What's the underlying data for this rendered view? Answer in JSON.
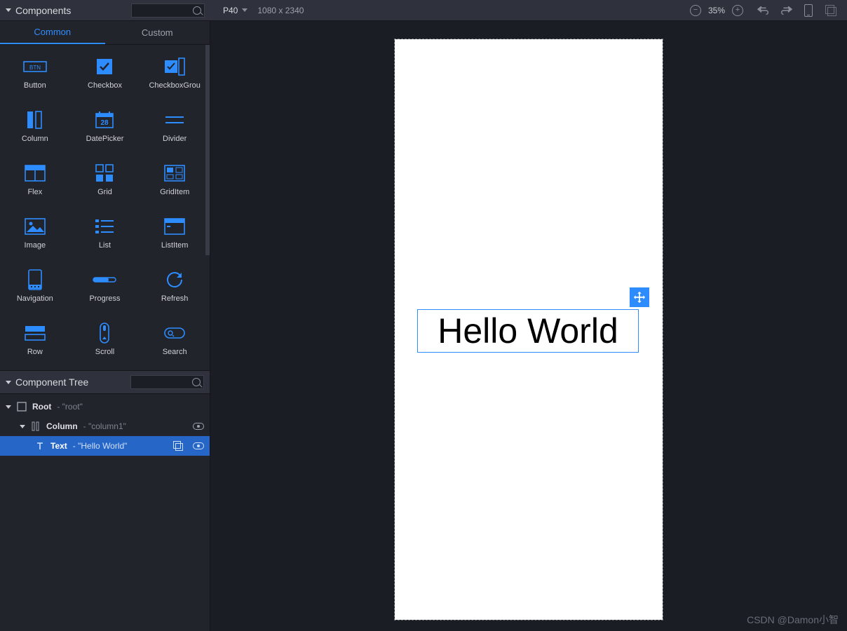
{
  "panels": {
    "components_title": "Components",
    "tree_title": "Component Tree"
  },
  "tabs": {
    "common": "Common",
    "custom": "Custom"
  },
  "device": {
    "name": "P40",
    "resolution": "1080 x 2340"
  },
  "zoom": {
    "value": "35%"
  },
  "components": [
    {
      "label": "Button",
      "icon": "button-icon"
    },
    {
      "label": "Checkbox",
      "icon": "checkbox-icon"
    },
    {
      "label": "CheckboxGrou",
      "icon": "checkbox-group-icon"
    },
    {
      "label": "Column",
      "icon": "column-icon"
    },
    {
      "label": "DatePicker",
      "icon": "datepicker-icon"
    },
    {
      "label": "Divider",
      "icon": "divider-icon"
    },
    {
      "label": "Flex",
      "icon": "flex-icon"
    },
    {
      "label": "Grid",
      "icon": "grid-icon"
    },
    {
      "label": "GridItem",
      "icon": "griditem-icon"
    },
    {
      "label": "Image",
      "icon": "image-icon"
    },
    {
      "label": "List",
      "icon": "list-icon"
    },
    {
      "label": "ListItem",
      "icon": "listitem-icon"
    },
    {
      "label": "Navigation",
      "icon": "navigation-icon"
    },
    {
      "label": "Progress",
      "icon": "progress-icon"
    },
    {
      "label": "Refresh",
      "icon": "refresh-icon"
    },
    {
      "label": "Row",
      "icon": "row-icon"
    },
    {
      "label": "Scroll",
      "icon": "scroll-icon"
    },
    {
      "label": "Search",
      "icon": "search-icon"
    }
  ],
  "tree": {
    "root": {
      "label": "Root",
      "hint": "- \"root\""
    },
    "column": {
      "label": "Column",
      "hint": "- \"column1\""
    },
    "text": {
      "label": "Text",
      "hint": "- \"Hello World\""
    }
  },
  "canvas": {
    "text": "Hello World"
  },
  "watermark": "CSDN @Damon小智"
}
